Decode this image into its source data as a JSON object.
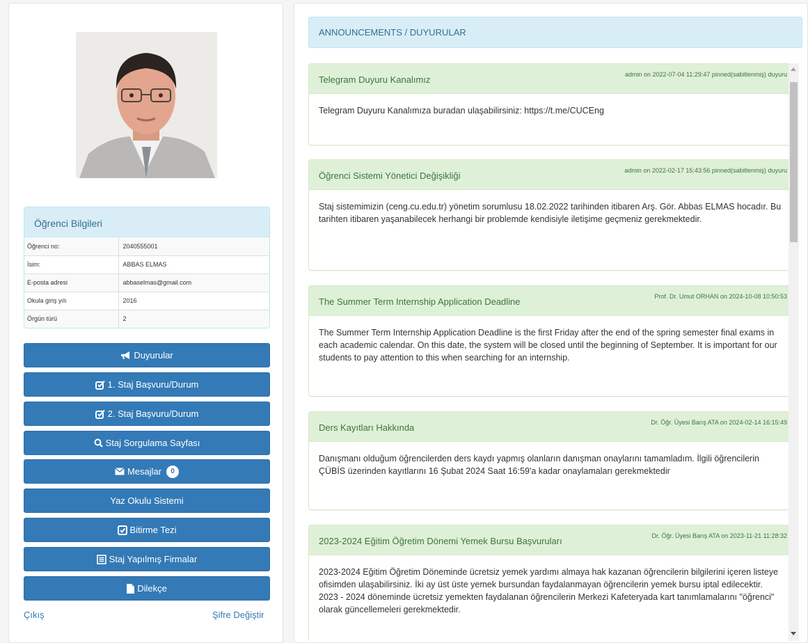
{
  "student_info": {
    "title": "Öğrenci Bilgileri",
    "rows": [
      {
        "label": "Öğrenci no:",
        "value": "2040555001"
      },
      {
        "label": "İsim:",
        "value": "ABBAS ELMAS"
      },
      {
        "label": "E-posta adresi",
        "value": "abbaselmas@gmail.com"
      },
      {
        "label": "Okula giriş yılı",
        "value": "2016"
      },
      {
        "label": "Örgün türü",
        "value": "2"
      }
    ]
  },
  "menu": {
    "duyurular": "Duyurular",
    "staj1": "1. Staj Başvuru/Durum",
    "staj2": "2. Staj Başvuru/Durum",
    "sorgulama": "Staj Sorgulama Sayfası",
    "mesajlar": "Mesajlar",
    "mesajlar_count": "0",
    "yaz_okulu": "Yaz Okulu Sistemi",
    "bitirme": "Bitirme Tezi",
    "firmalar": "Staj Yapılmış Firmalar",
    "dilekce": "Dilekçe"
  },
  "footer_links": {
    "logout": "Çıkış",
    "change_password": "Şifre Değiştir"
  },
  "announcements_header": "ANNOUNCEMENTS / DUYURULAR",
  "announcements": [
    {
      "title": "Telegram Duyuru Kanalımız",
      "meta": "admin on 2022-07-04 11:29:47 pinned(sabitlenmiş) duyuru",
      "body": "Telegram Duyuru Kanalımıza buradan ulaşabilirsiniz: https://t.me/CUCEng"
    },
    {
      "title": "Öğrenci Sistemi Yönetici Değişikliği",
      "meta": "admin on 2022-02-17 15:43:56 pinned(sabitlenmiş) duyuru",
      "body": "Staj sistemimizin (ceng.cu.edu.tr) yönetim sorumlusu 18.02.2022 tarihinden itibaren Arş. Gör. Abbas ELMAS hocadır. Bu tarihten itibaren yaşanabilecek herhangi bir problemde kendisiyle iletişime geçmeniz gerekmektedir."
    },
    {
      "title": "The Summer Term Internship Application Deadline",
      "meta": "Prof. Dr. Umut ORHAN on 2024-10-08 10:50:53",
      "body": "The Summer Term Internship Application Deadline is the first Friday after the end of the spring semester final exams in each academic calendar. On this date, the system will be closed until the beginning of September. It is important for our students to pay attention to this when searching for an internship."
    },
    {
      "title": "Ders Kayıtları Hakkında",
      "meta": "Dr. Öğr. Üyesi Barış ATA on 2024-02-14 16:15:49",
      "body": "Danışmanı olduğum öğrencilerden ders kaydı yapmış olanların danışman onaylarını tamamladım. İlgili öğrencilerin ÇÜBİS üzerinden kayıtlarını 16 Şubat 2024 Saat 16:59'a kadar onaylamaları gerekmektedir"
    },
    {
      "title": "2023-2024 Eğitim Öğretim Dönemi Yemek Bursu Başvuruları",
      "meta": "Dr. Öğr. Üyesi Barış ATA on 2023-11-21 11:28:32",
      "body": "2023-2024 Eğitim Öğretim Döneminde ücretsiz yemek yardımı almaya hak kazanan öğrencilerin bilgilerini içeren listeye ofisimden ulaşabilirsiniz. İki ay üst üste yemek bursundan faydalanmayan öğrencilerin yemek bursu iptal edilecektir. 2023 - 2024 döneminde ücretsiz yemekten faydalanan öğrencilerin Merkezi Kafeteryada kart tanımlamalarını \"öğrenci\" olarak güncellemeleri gerekmektedir."
    }
  ],
  "colors": {
    "primary": "#337ab7",
    "info_bg": "#d9edf7",
    "success_bg": "#dff0d8",
    "success_text": "#3c763d"
  }
}
